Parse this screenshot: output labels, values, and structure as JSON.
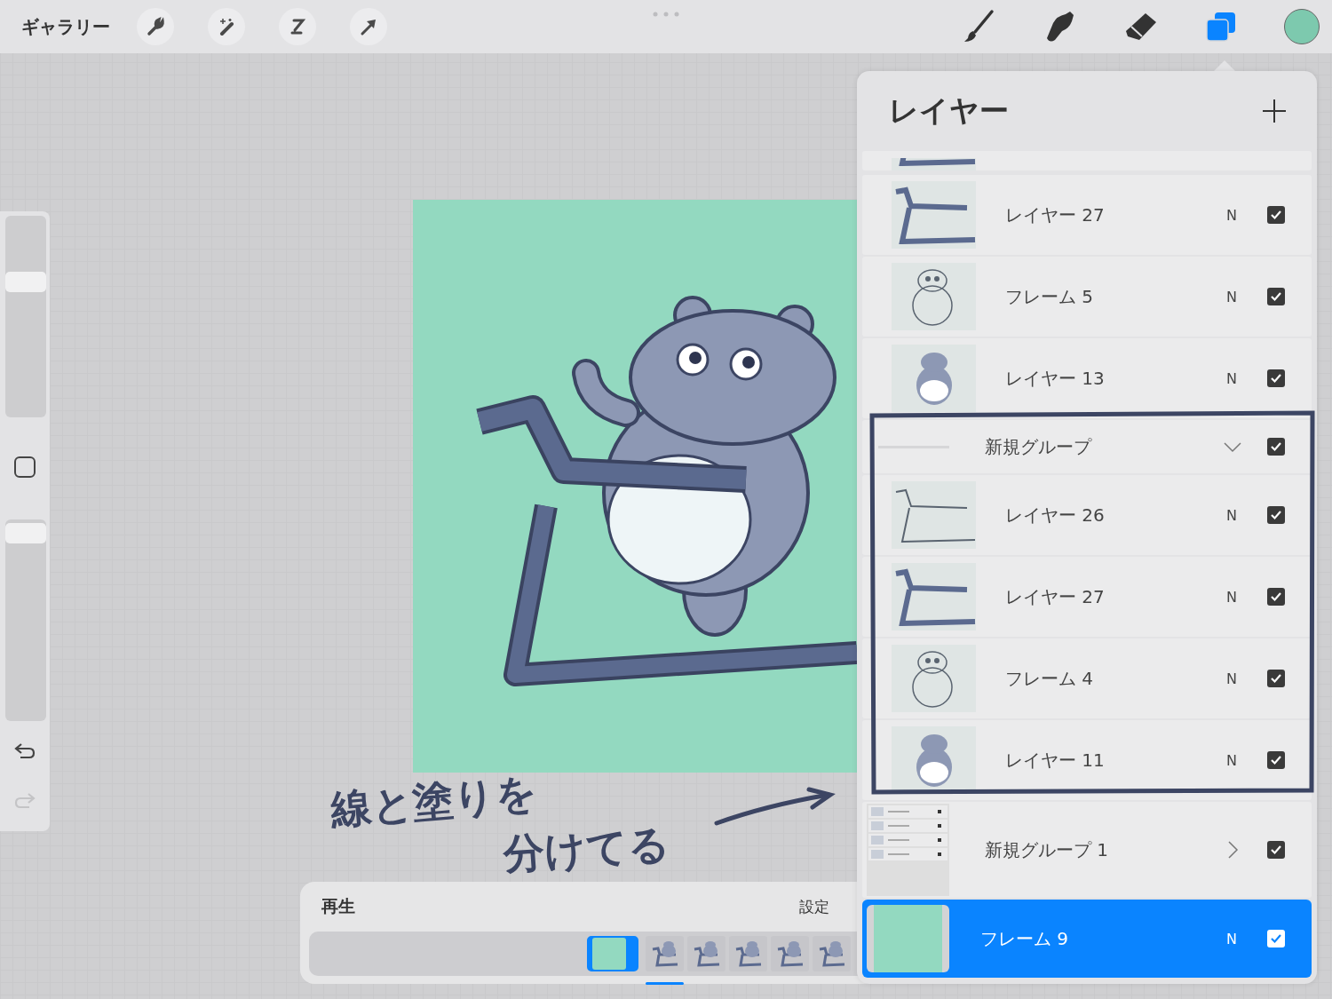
{
  "top_bar": {
    "gallery": "ギャラリー",
    "left_tools": [
      {
        "kind": "wrench"
      },
      {
        "kind": "wand"
      },
      {
        "kind": "selection"
      },
      {
        "kind": "transform"
      }
    ],
    "right_tools": [
      {
        "kind": "brush",
        "selected": false
      },
      {
        "kind": "smudge",
        "selected": false
      },
      {
        "kind": "eraser",
        "selected": false
      },
      {
        "kind": "layers",
        "selected": true
      }
    ],
    "color": "#7dc9ae"
  },
  "sidebar": {
    "sliders": [
      {
        "level": 0.69
      },
      {
        "level": 0.98
      }
    ],
    "redo_disabled": true
  },
  "layers_panel": {
    "title": "レイヤー",
    "layers": [
      {
        "kind": "partial",
        "thumb": {
          "kind": "treadmill"
        }
      },
      {
        "kind": "layer",
        "name": "レイヤー 27",
        "mode": "N",
        "thumb": {
          "kind": "treadmill"
        },
        "visible": true,
        "selected": false
      },
      {
        "kind": "layer",
        "name": "フレーム 5",
        "mode": "N",
        "thumb": {
          "kind": "bear"
        },
        "visible": true,
        "selected": false
      },
      {
        "kind": "layer",
        "name": "レイヤー 13",
        "mode": "N",
        "thumb": {
          "kind": "bear-front"
        },
        "visible": true,
        "selected": false
      },
      {
        "kind": "group",
        "name": "新規グループ",
        "expanded": true,
        "visible": true,
        "selected": false,
        "children": [
          {
            "kind": "layer",
            "name": "レイヤー 26",
            "mode": "N",
            "thumb": {
              "kind": "treadmill-outline"
            },
            "visible": true,
            "selected": false
          },
          {
            "kind": "layer",
            "name": "レイヤー 27",
            "mode": "N",
            "thumb": {
              "kind": "treadmill"
            },
            "visible": true,
            "selected": false
          },
          {
            "kind": "layer",
            "name": "フレーム 4",
            "mode": "N",
            "thumb": {
              "kind": "bear"
            },
            "visible": true,
            "selected": false
          },
          {
            "kind": "layer",
            "name": "レイヤー 11",
            "mode": "N",
            "thumb": {
              "kind": "bear-front"
            },
            "visible": true,
            "selected": false
          }
        ]
      },
      {
        "kind": "group",
        "name": "新規グループ 1",
        "expanded": false,
        "visible": true,
        "selected": false,
        "thumb": {
          "kind": "group"
        }
      },
      {
        "kind": "layer",
        "name": "フレーム 9",
        "mode": "N",
        "thumb": {
          "kind": "solid"
        },
        "visible": true,
        "selected": true
      }
    ]
  },
  "timeline": {
    "title": "再生",
    "settings": "設定",
    "frames": [
      {
        "thumb": {
          "kind": "solid"
        },
        "selected": true,
        "playhead": false
      },
      {
        "thumb": {
          "kind": "frame"
        },
        "selected": false,
        "playhead": true
      },
      {
        "thumb": {
          "kind": "frame"
        },
        "selected": false,
        "playhead": false
      },
      {
        "thumb": {
          "kind": "frame"
        },
        "selected": false,
        "playhead": false
      },
      {
        "thumb": {
          "kind": "frame"
        },
        "selected": false,
        "playhead": false
      },
      {
        "thumb": {
          "kind": "frame"
        },
        "selected": false,
        "playhead": false
      }
    ]
  },
  "annotation": {
    "lines": [
      "線と塗りを",
      "分けてる"
    ]
  }
}
